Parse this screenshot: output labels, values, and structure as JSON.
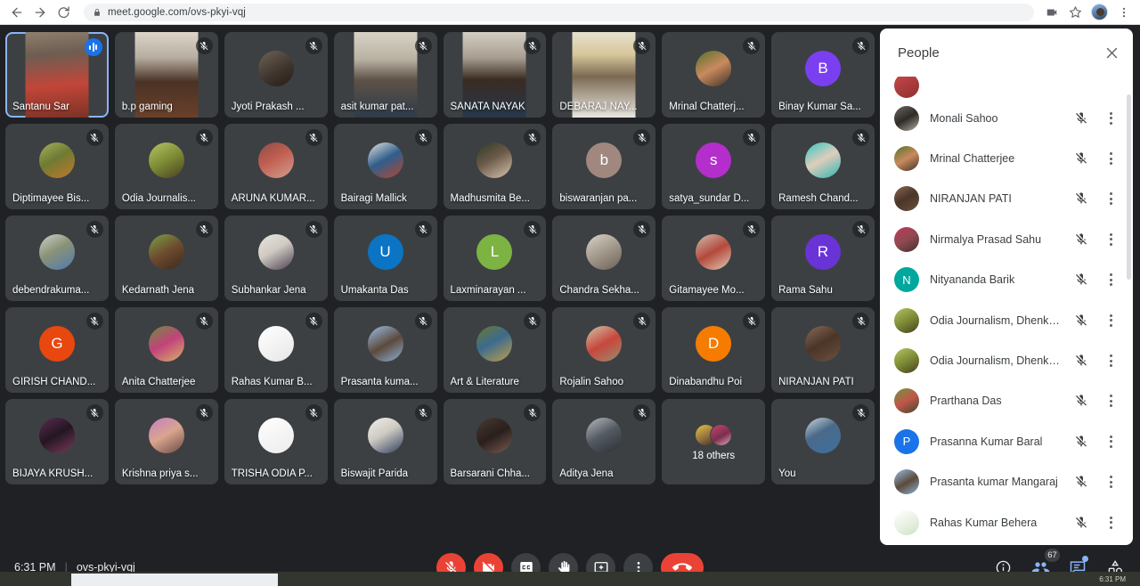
{
  "browser": {
    "url": "meet.google.com/ovs-pkyi-vqj",
    "back_label": "Back",
    "forward_label": "Forward",
    "reload_label": "Reload",
    "lock_icon": "lock-icon",
    "media_icon": "camera-indicator-icon",
    "bookmark_icon": "star-icon",
    "menu_icon": "chrome-menu-icon"
  },
  "grid": {
    "tiles": [
      {
        "name": "Santanu Sar",
        "kind": "video",
        "active": true,
        "muted": false,
        "speaking": true,
        "video": "linear-gradient(175deg,#8f7f6d 0%,#6d5e52 26%,#c24639 62%,#7b3226 100%)"
      },
      {
        "name": "b.p gaming",
        "kind": "video",
        "active": false,
        "muted": true,
        "video": "linear-gradient(180deg,#dcd6c8 0%,#b6ada0 30%,#4a3226 58%,#6b4029 100%)"
      },
      {
        "name": "Jyoti Prakash ...",
        "kind": "avatar",
        "active": false,
        "muted": true,
        "avatar": "linear-gradient(150deg,#6f6257 0%,#3d332b 60%,#241d18 100%)",
        "initial": ""
      },
      {
        "name": "asit kumar pat...",
        "kind": "video",
        "active": false,
        "muted": true,
        "video": "linear-gradient(180deg,#d8d3c6 0%,#b9b2a3 32%,#5e5248 56%,#2d3b4a 100%)"
      },
      {
        "name": "SANATA NAYAK",
        "kind": "video",
        "active": false,
        "muted": true,
        "video": "linear-gradient(180deg,#d3cec2 0%,#a79e90 30%,#3a2b22 56%,#26384c 100%)"
      },
      {
        "name": "DEBARAJ NAY...",
        "kind": "video",
        "active": false,
        "muted": true,
        "video": "linear-gradient(180deg,#e6e0cf 0%,#d8c79a 26%,#7b6a52 52%,#e8e6e1 100%)"
      },
      {
        "name": "Mrinal Chatterj...",
        "kind": "avatar",
        "active": false,
        "muted": true,
        "avatar": "linear-gradient(150deg,#55702c 0%,#c98a5e 50%,#3f3226 100%)",
        "initial": ""
      },
      {
        "name": "Binay Kumar Sa...",
        "kind": "initial",
        "active": false,
        "muted": true,
        "avatar": "#7b3ff2",
        "initial": "B"
      },
      {
        "name": "Diptimayee Bis...",
        "kind": "avatar",
        "active": false,
        "muted": true,
        "avatar": "linear-gradient(150deg,#a4b45c 0%,#6f7a33 45%,#c4782c 100%)",
        "initial": ""
      },
      {
        "name": "Odia Journalis...",
        "kind": "avatar",
        "active": false,
        "muted": true,
        "avatar": "linear-gradient(150deg,#b6c565 0%,#7d8c35 50%,#4a3d22 100%)",
        "initial": ""
      },
      {
        "name": "ARUNA KUMAR...",
        "kind": "avatar",
        "active": false,
        "muted": true,
        "avatar": "linear-gradient(150deg,#8e4b44 0%,#c05f52 45%,#d3a08f 100%)",
        "initial": ""
      },
      {
        "name": "Bairagi Mallick",
        "kind": "avatar",
        "active": false,
        "muted": true,
        "avatar": "linear-gradient(150deg,#e9e5de 0%,#2f5e8c 48%,#b7452f 100%)",
        "initial": ""
      },
      {
        "name": "Madhusmita Be...",
        "kind": "avatar",
        "active": false,
        "muted": true,
        "avatar": "linear-gradient(150deg,#2e3a26 0%,#6b5a48 45%,#d6c5b0 100%)",
        "initial": ""
      },
      {
        "name": "biswaranjan pa...",
        "kind": "initial",
        "active": false,
        "muted": true,
        "avatar": "#a1887f",
        "initial": "b"
      },
      {
        "name": "satya_sundar D...",
        "kind": "initial",
        "active": false,
        "muted": true,
        "avatar": "#b32ecb",
        "initial": "s"
      },
      {
        "name": "Ramesh Chand...",
        "kind": "avatar",
        "active": false,
        "muted": true,
        "avatar": "linear-gradient(150deg,#2ec7c1 0%,#e0cdbb 48%,#2ab5b0 100%)",
        "initial": ""
      },
      {
        "name": "debendrakuma...",
        "kind": "avatar",
        "active": false,
        "muted": true,
        "avatar": "linear-gradient(150deg,#cfd2cd 0%,#8a9276 45%,#4f7ab0 100%)",
        "initial": ""
      },
      {
        "name": "Kedarnath Jena",
        "kind": "avatar",
        "active": false,
        "muted": true,
        "avatar": "linear-gradient(150deg,#7ba245 0%,#6d4a2e 50%,#3c2a1c 100%)",
        "initial": ""
      },
      {
        "name": "Subhankar Jena",
        "kind": "avatar",
        "active": false,
        "muted": true,
        "avatar": "linear-gradient(150deg,#e8e6e1 0%,#cfcac2 45%,#4a3f52 100%)",
        "initial": ""
      },
      {
        "name": "Umakanta Das",
        "kind": "initial",
        "active": false,
        "muted": true,
        "avatar": "#0b74c4",
        "initial": "U"
      },
      {
        "name": "Laxminarayan ...",
        "kind": "initial",
        "active": false,
        "muted": true,
        "avatar": "#7cb342",
        "initial": "L"
      },
      {
        "name": "Chandra Sekha...",
        "kind": "avatar",
        "active": false,
        "muted": true,
        "avatar": "linear-gradient(150deg,#d9d4cb 0%,#a49a8d 48%,#6b6056 100%)",
        "initial": ""
      },
      {
        "name": "Gitamayee Mo...",
        "kind": "avatar",
        "active": false,
        "muted": true,
        "avatar": "linear-gradient(150deg,#cdbfae 0%,#b4493c 50%,#e0cbb5 100%)",
        "initial": ""
      },
      {
        "name": "Rama Sahu",
        "kind": "initial",
        "active": false,
        "muted": true,
        "avatar": "#6a33d6",
        "initial": "R"
      },
      {
        "name": "GIRISH CHAND...",
        "kind": "initial",
        "active": false,
        "muted": true,
        "avatar": "#e8470f",
        "initial": "G"
      },
      {
        "name": "Anita Chatterjee",
        "kind": "avatar",
        "active": false,
        "muted": true,
        "avatar": "linear-gradient(150deg,#6e8f3e 0%,#c2427a 48%,#d8b36a 100%)",
        "initial": ""
      },
      {
        "name": "Rahas Kumar B...",
        "kind": "avatar",
        "active": false,
        "muted": true,
        "avatar": "linear-gradient(150deg,#ffffff 0%,#f2f2f2 55%,#e6e6e6 100%)",
        "initial": ""
      },
      {
        "name": "Prasanta kuma...",
        "kind": "avatar",
        "active": false,
        "muted": true,
        "avatar": "linear-gradient(150deg,#9cc0e8 0%,#5b4a3c 52%,#8fb2d8 100%)",
        "initial": ""
      },
      {
        "name": "Art & Literature",
        "kind": "avatar",
        "active": false,
        "muted": true,
        "avatar": "linear-gradient(150deg,#6b7a2c 0%,#3c6a8e 45%,#c0a04a 100%)",
        "initial": ""
      },
      {
        "name": "Rojalin Sahoo",
        "kind": "avatar",
        "active": false,
        "muted": true,
        "avatar": "linear-gradient(150deg,#cfc6a8 0%,#c7473c 50%,#9a8e6e 100%)",
        "initial": ""
      },
      {
        "name": "Dinabandhu Poi",
        "kind": "initial",
        "active": false,
        "muted": true,
        "avatar": "#f57c00",
        "initial": "D"
      },
      {
        "name": "NIRANJAN PATI",
        "kind": "avatar",
        "active": false,
        "muted": true,
        "avatar": "linear-gradient(150deg,#8a6a58 0%,#4a3528 48%,#6d5140 100%)",
        "initial": ""
      },
      {
        "name": "BIJAYA KRUSH...",
        "kind": "avatar",
        "active": false,
        "muted": true,
        "avatar": "linear-gradient(150deg,#5a2c52 0%,#241622 48%,#7b3a5e 100%)",
        "initial": ""
      },
      {
        "name": "Krishna priya s...",
        "kind": "avatar",
        "active": false,
        "muted": true,
        "avatar": "linear-gradient(150deg,#c27ec4 0%,#d9a58e 48%,#6a4a42 100%)",
        "initial": ""
      },
      {
        "name": "TRISHA ODIA P...",
        "kind": "avatar",
        "active": false,
        "muted": true,
        "avatar": "linear-gradient(150deg,#ffffff 0%,#f4f4f4 55%,#ececec 100%)",
        "initial": ""
      },
      {
        "name": "Biswajit Parida",
        "kind": "avatar",
        "active": false,
        "muted": true,
        "avatar": "linear-gradient(150deg,#f0efec 0%,#cfcac2 45%,#2c3e5e 100%)",
        "initial": ""
      },
      {
        "name": "Barsarani Chha...",
        "kind": "avatar",
        "active": false,
        "muted": true,
        "avatar": "linear-gradient(150deg,#4a3a33 0%,#2a1f1c 50%,#7a5c50 100%)",
        "initial": ""
      },
      {
        "name": "Aditya Jena",
        "kind": "avatar",
        "active": false,
        "muted": true,
        "avatar": "linear-gradient(150deg,#b9bcc0 0%,#545a62 48%,#2b2f34 100%)",
        "initial": ""
      },
      {
        "name": "18 others",
        "kind": "others",
        "active": false,
        "muted": false,
        "avatar_a": "linear-gradient(150deg,#e8c547 0%,#8a6a3c 60%,#3a2a1e 100%)",
        "avatar_b": "linear-gradient(150deg,#c9466e 0%,#7b2f4e 55%,#e0a8b8 100%)"
      },
      {
        "name": "You",
        "kind": "avatar",
        "active": false,
        "muted": true,
        "avatar": "linear-gradient(150deg,#cfd8dc 0%,#4a6a8a 42%,#3d6f9e 100%)",
        "initial": ""
      }
    ]
  },
  "people_panel": {
    "title": "People",
    "close_label": "Close",
    "rows": [
      {
        "name": "",
        "avatar": "linear-gradient(150deg,#c94a4a 0%,#8e2f2f 100%)",
        "initial": "",
        "clipped": true
      },
      {
        "name": "Monali Sahoo",
        "avatar": "linear-gradient(150deg,#6e6a63 0%,#2e2a26 50%,#b9aea0 100%)",
        "initial": ""
      },
      {
        "name": "Mrinal Chatterjee",
        "avatar": "linear-gradient(150deg,#55702c 0%,#c98a5e 50%,#3f3226 100%)",
        "initial": ""
      },
      {
        "name": "NIRANJAN PATI",
        "avatar": "linear-gradient(150deg,#8a6a58 0%,#4a3528 48%,#6d5140 100%)",
        "initial": ""
      },
      {
        "name": "Nirmalya Prasad Sahu",
        "avatar": "linear-gradient(150deg,#c2385a 0%,#8e4a52 50%,#4a2e2c 100%)",
        "initial": ""
      },
      {
        "name": "Nityananda Barik",
        "avatar": "#00a79d",
        "initial": "N"
      },
      {
        "name": "Odia Journalism, Dhenka...",
        "avatar": "linear-gradient(150deg,#b6c565 0%,#7d8c35 50%,#4a3d22 100%)",
        "initial": ""
      },
      {
        "name": "Odia Journalism, Dhenka...",
        "avatar": "linear-gradient(150deg,#b6c565 0%,#7d8c35 50%,#4a3d22 100%)",
        "initial": ""
      },
      {
        "name": "Prarthana Das",
        "avatar": "linear-gradient(150deg,#6a9a3c 0%,#c2564a 50%,#3c4a2c 100%)",
        "initial": ""
      },
      {
        "name": "Prasanna Kumar Baral",
        "avatar": "#1a73e8",
        "initial": "P"
      },
      {
        "name": "Prasanta kumar Mangaraj",
        "avatar": "linear-gradient(150deg,#9cc0e8 0%,#5b4a3c 52%,#8fb2d8 100%)",
        "initial": ""
      },
      {
        "name": "Rahas Kumar Behera",
        "avatar": "linear-gradient(150deg,#ffffff 0%,#e8f0e2 55%,#cfe0c6 100%)",
        "initial": ""
      }
    ]
  },
  "bottom_bar": {
    "time": "6:31 PM",
    "separator": "|",
    "meeting_code": "ovs-pkyi-vqj",
    "controls": [
      {
        "id": "microphone-off-button",
        "icon": "mic-off-icon",
        "style": "danger"
      },
      {
        "id": "camera-off-button",
        "icon": "camera-off-icon",
        "style": "danger"
      },
      {
        "id": "captions-button",
        "icon": "closed-captions-icon",
        "style": "normal"
      },
      {
        "id": "raise-hand-button",
        "icon": "raise-hand-icon",
        "style": "normal"
      },
      {
        "id": "present-screen-button",
        "icon": "present-screen-icon",
        "style": "normal"
      },
      {
        "id": "more-options-button",
        "icon": "more-vertical-icon",
        "style": "normal"
      },
      {
        "id": "leave-call-button",
        "icon": "phone-hangup-icon",
        "style": "hangup"
      }
    ],
    "right_controls": [
      {
        "id": "meeting-details-button",
        "icon": "info-icon",
        "badge": ""
      },
      {
        "id": "show-everyone-button",
        "icon": "people-icon",
        "badge": "67"
      },
      {
        "id": "chat-button",
        "icon": "chat-icon",
        "badge": ""
      },
      {
        "id": "activities-button",
        "icon": "activities-icon",
        "badge": ""
      }
    ]
  },
  "os_taskbar": {
    "clock": "6:31 PM"
  }
}
